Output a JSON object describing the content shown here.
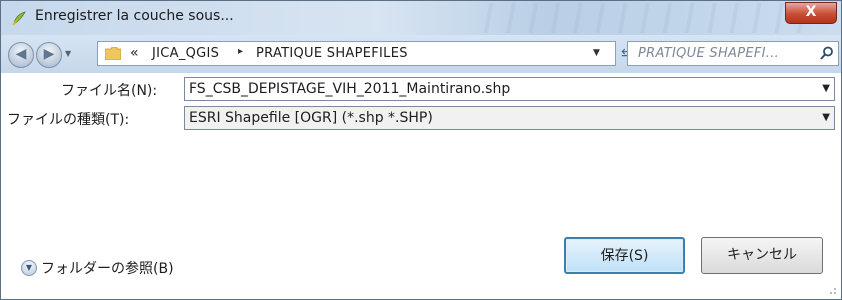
{
  "window": {
    "title": "Enregistrer la couche sous...",
    "close_label": "X"
  },
  "navbar": {
    "chevron": "«",
    "path": [
      "JICA_QGIS",
      "PRATIQUE SHAPEFILES"
    ],
    "separator": "▸",
    "search_placeholder": "PRATIQUE SHAPEFI..."
  },
  "form": {
    "filename_label": "ファイル名(N):",
    "filename_value": "FS_CSB_DEPISTAGE_VIH_2011_Maintirano.shp",
    "filetype_label": "ファイルの種類(T):",
    "filetype_value": "ESRI Shapefile [OGR] (*.shp *.SHP)"
  },
  "footer": {
    "browse_label": "フォルダーの参照(B)",
    "save_label": "保存(S)",
    "cancel_label": "キャンセル"
  },
  "icons": {
    "app": "qgis-icon",
    "back": "back-arrow-icon",
    "forward": "forward-arrow-icon",
    "folder": "folder-icon",
    "refresh": "refresh-icon",
    "search": "search-icon",
    "expand": "expand-chevron-icon"
  },
  "colors": {
    "titlebar": "#c6d8ec",
    "close": "#c74e35",
    "save_border": "#3c7fb1"
  }
}
